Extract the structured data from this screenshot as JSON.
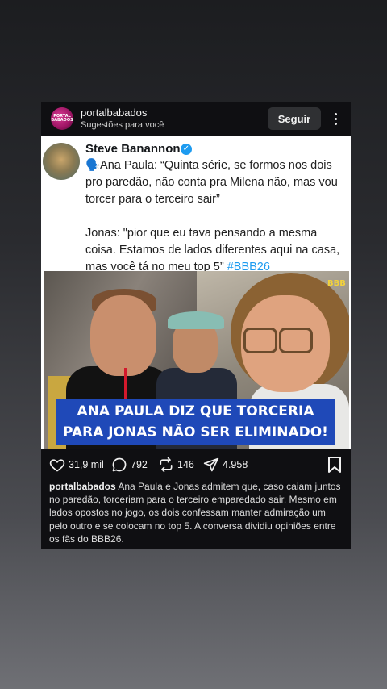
{
  "post": {
    "username": "portalbabados",
    "subtitle": "Sugestões para você",
    "follow_label": "Seguir",
    "avatar_text": "PORTAL BABADOS",
    "more_icon": "more-vertical-icon"
  },
  "tweet": {
    "author": "Steve Banannon",
    "verified_icon": "verified-check-icon",
    "line1": "🗣️Ana Paula: “Quinta série, se formos nos dois pro paredão, não conta pra Milena não, mas vou torcer para o terceiro sair”",
    "line2": "Jonas: \"pior que eu tava pensando a mesma coisa. Estamos de lados diferentes aqui na casa, mas você tá no meu top 5”",
    "hashtag": "#BBB26",
    "banner": "ANA PAULA DIZ QUE TORCERIA PARA JONAS NÃO SER ELIMINADO!",
    "watermark": "BBB"
  },
  "actions": {
    "likes": "31,9 mil",
    "comments": "792",
    "reposts": "146",
    "shares": "4.958",
    "icons": [
      "heart-icon",
      "comment-icon",
      "repost-icon",
      "send-icon",
      "bookmark-icon"
    ]
  },
  "caption": {
    "username": "portalbabados",
    "text": "Ana Paula e Jonas admitem que, caso caiam juntos no paredão, torceriam para o terceiro emparedado sair. Mesmo em lados opostos no jogo, os dois confessam manter admiração um pelo outro e se colocam no top 5. A conversa dividiu opiniões entre os fãs do BBB26."
  },
  "colors": {
    "accent_blue": "#1d9bf0",
    "banner_blue": "#1f49b8",
    "card_bg": "#0f0f12"
  }
}
